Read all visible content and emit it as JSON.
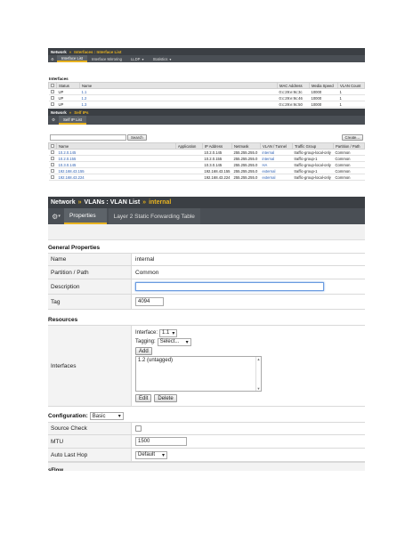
{
  "panel1": {
    "breadcrumb": [
      "Network",
      "Interfaces : Interface List"
    ],
    "tabs": [
      "Interface List",
      "Interface Mirroring",
      "LLDP",
      "Statistics"
    ],
    "section_title": "Interfaces",
    "columns": [
      "Status",
      "Name",
      "MAC Address",
      "Media Speed",
      "VLAN Count"
    ],
    "rows": [
      {
        "status": "UP",
        "name": "1.1",
        "mac": "0:c:29:e:9c:3c",
        "speed": "10000",
        "vlans": "1"
      },
      {
        "status": "UP",
        "name": "1.2",
        "mac": "0:c:29:e:9c:46",
        "speed": "10000",
        "vlans": "1"
      },
      {
        "status": "UP",
        "name": "1.3",
        "mac": "0:c:29:e:9c:50",
        "speed": "10000",
        "vlans": "1"
      }
    ]
  },
  "panel2": {
    "breadcrumb": [
      "Network",
      "Self IPs"
    ],
    "tabs": [
      "Self IP List"
    ],
    "search_button": "Search",
    "create_button": "Create...",
    "columns": [
      "Name",
      "Application",
      "IP Address",
      "Netmask",
      "VLAN / Tunnel",
      "Traffic Group",
      "Partition / Path"
    ],
    "rows": [
      {
        "name": "10.2.0.145",
        "app": "",
        "ip": "10.2.0.145",
        "mask": "255.255.255.0",
        "vlan": "internal",
        "tg": "traffic-group-local-only",
        "part": "Common"
      },
      {
        "name": "10.2.0.155",
        "app": "",
        "ip": "10.2.0.155",
        "mask": "255.255.255.0",
        "vlan": "internal",
        "tg": "traffic-group-1",
        "part": "Common"
      },
      {
        "name": "10.3.0.145",
        "app": "",
        "ip": "10.3.0.145",
        "mask": "255.255.255.0",
        "vlan": "HA",
        "tg": "traffic-group-local-only",
        "part": "Common"
      },
      {
        "name": "192.168.43.155",
        "app": "",
        "ip": "192.168.43.155",
        "mask": "255.255.255.0",
        "vlan": "external",
        "tg": "traffic-group-1",
        "part": "Common"
      },
      {
        "name": "192.168.43.224",
        "app": "",
        "ip": "192.168.43.224",
        "mask": "255.255.255.0",
        "vlan": "external",
        "tg": "traffic-group-local-only",
        "part": "Common"
      }
    ]
  },
  "panel3": {
    "breadcrumb": [
      "Network",
      "VLANs : VLAN List",
      "internal"
    ],
    "tabs": [
      "Properties",
      "Layer 2 Static Forwarding Table"
    ],
    "general_title": "General Properties",
    "name_label": "Name",
    "name_value": "internal",
    "partition_label": "Partition / Path",
    "partition_value": "Common",
    "description_label": "Description",
    "description_value": "",
    "tag_label": "Tag",
    "tag_value": "4094",
    "resources_title": "Resources",
    "interfaces_label": "Interfaces",
    "interface_label": "Interface:",
    "interface_value": "1.1",
    "tagging_label": "Tagging:",
    "tagging_value": "Select...",
    "add_button": "Add",
    "interface_list": [
      "1.2 (untagged)"
    ],
    "edit_button": "Edit",
    "delete_button": "Delete",
    "configuration_label": "Configuration:",
    "configuration_value": "Basic",
    "source_check_label": "Source Check",
    "mtu_label": "MTU",
    "mtu_value": "1500",
    "auto_last_hop_label": "Auto Last Hop",
    "auto_last_hop_value": "Default",
    "cut_text": "sFlow"
  },
  "colors": {
    "header_bg": "#3b3f44",
    "accent": "#e8b321",
    "link": "#2a5db0"
  }
}
